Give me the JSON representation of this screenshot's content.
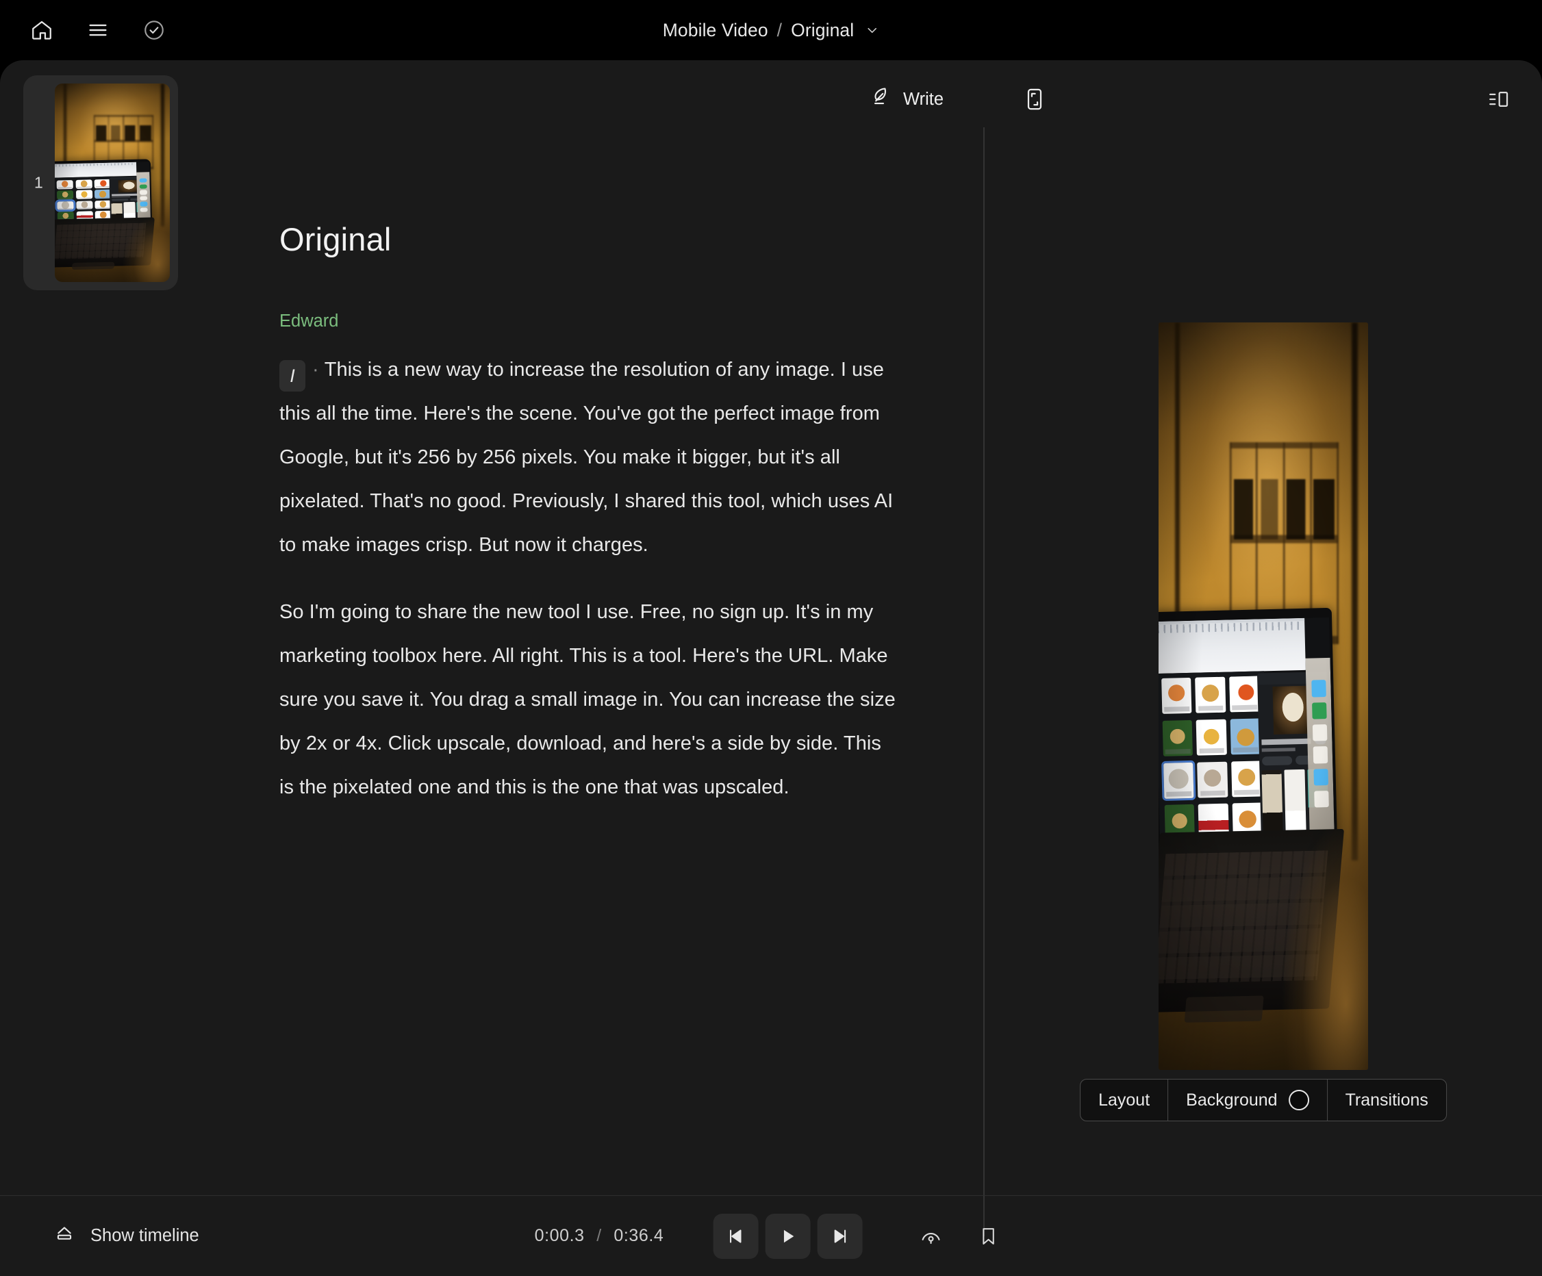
{
  "app": {
    "background_color": "#1a1a1a",
    "topbar_color": "#000000",
    "accent_speaker_color": "#7bbd7e"
  },
  "topbar": {
    "home_icon": "home-icon",
    "menu_icon": "hamburger-menu-icon",
    "check_icon": "check-circle-icon",
    "breadcrumb": {
      "project": "Mobile Video",
      "separator": "/",
      "current": "Original",
      "chevron": "chevron-down-icon"
    }
  },
  "thumbnail_rail": {
    "scenes": [
      {
        "number": "1",
        "selected": true
      }
    ]
  },
  "transcript": {
    "toolbar": {
      "write_label": "Write",
      "write_icon": "quill-pen-icon"
    },
    "title": "Original",
    "speaker": "Edward",
    "play_marker": "I",
    "marker_dot": "·",
    "paragraphs": [
      "This is a new way to increase the resolution of any image. I use this all the time. Here's the scene. You've got the perfect image from Google, but it's 256 by 256 pixels. You make it bigger, but it's all pixelated. That's no good. Previously, I shared this tool, which uses AI to make images crisp. But now it charges.",
      "So I'm going to share the new tool I use. Free, no sign up. It's in my marketing toolbox here. All right. This is a tool. Here's the URL. Make sure you save it. You drag a small image in. You can increase the size by 2x or 4x. Click upscale, download, and here's a side by side. This is the pixelated one and this is the one that was upscaled."
    ]
  },
  "preview": {
    "frame_icon": "crop-frame-icon",
    "panel_toggle_icon": "toggle-side-panel-icon",
    "media_description": "Laptop on a desk displaying a Google Images search results page of dog pictures, in a warmly lit room",
    "controls": [
      {
        "label": "Layout",
        "icon": null
      },
      {
        "label": "Background",
        "icon": "color-swatch-circle",
        "swatch_color": "#0b0b0b"
      },
      {
        "label": "Transitions",
        "icon": null
      }
    ]
  },
  "bottombar": {
    "show_timeline_label": "Show timeline",
    "show_timeline_icon": "eject-timeline-icon",
    "current_time": "0:00.3",
    "time_separator": "/",
    "total_time": "0:36.4",
    "transport": [
      {
        "name": "skip-back-button",
        "icon": "skip-back-icon"
      },
      {
        "name": "play-button",
        "icon": "play-icon"
      },
      {
        "name": "skip-forward-button",
        "icon": "skip-forward-icon"
      }
    ],
    "speed_icon": "playback-speed-icon",
    "bookmark_icon": "bookmark-icon"
  }
}
